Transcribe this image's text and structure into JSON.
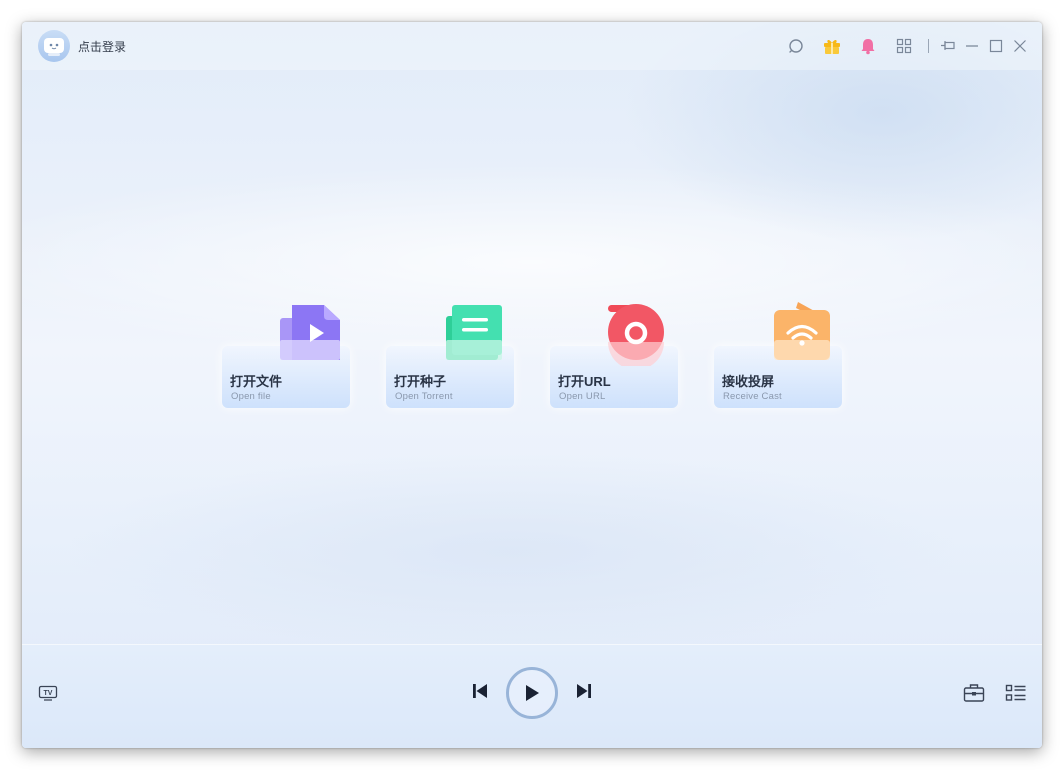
{
  "titlebar": {
    "login_label": "点击登录"
  },
  "icons": {
    "titlebar": [
      "avatar-icon",
      "search-icon",
      "gift-icon",
      "bell-icon",
      "apps-grid-icon",
      "pin-icon",
      "minimize-icon",
      "maximize-icon",
      "close-icon"
    ],
    "bottombar": [
      "tv-icon",
      "previous-track-icon",
      "play-icon",
      "next-track-icon",
      "toolbox-icon",
      "playlist-icon"
    ]
  },
  "colors": {
    "gift": "#f7b918",
    "bell": "#f16fa5",
    "open_file": "#8c76f4",
    "open_torrent": "#3fd9a8",
    "open_url": "#f04a57",
    "receive_cast": "#f8a456"
  },
  "actions": [
    {
      "title": "打开文件",
      "subtitle": "Open file",
      "icon": "video-file-icon"
    },
    {
      "title": "打开种子",
      "subtitle": "Open Torrent",
      "icon": "torrent-doc-icon"
    },
    {
      "title": "打开URL",
      "subtitle": "Open URL",
      "icon": "url-record-icon"
    },
    {
      "title": "接收投屏",
      "subtitle": "Receive Cast",
      "icon": "wifi-cast-icon"
    }
  ]
}
